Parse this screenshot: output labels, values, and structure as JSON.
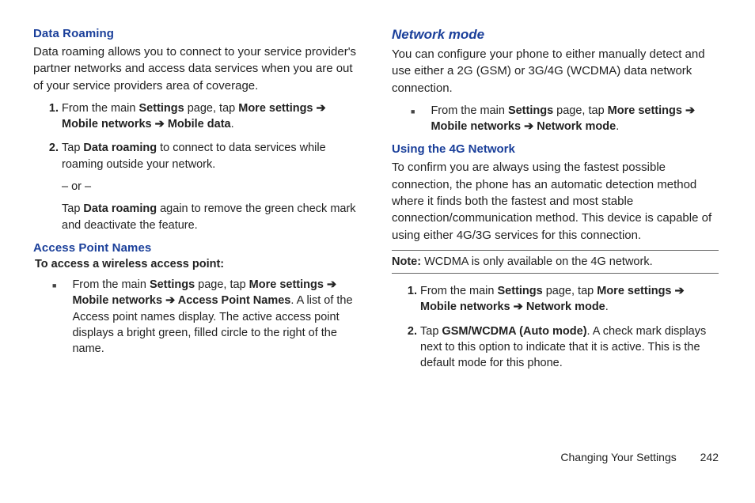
{
  "left": {
    "data_roaming": {
      "heading": "Data Roaming",
      "intro": "Data roaming allows you to connect to your service provider's partner networks and access data services when you are out of your service providers area of coverage.",
      "step1_pre": "From the main ",
      "settings": "Settings",
      "step1_mid": " page, tap ",
      "more_settings": "More settings",
      "arrow": " ➔ ",
      "mobile_networks": "Mobile networks",
      "mobile_data": "Mobile data",
      "period": ".",
      "step2_pre": "Tap ",
      "data_roaming_bold": "Data roaming",
      "step2_post": " to connect to data services while roaming outside your network.",
      "or": "– or –",
      "step2b_pre": "Tap ",
      "step2b_post": " again to remove the green check mark and deactivate the feature."
    },
    "apn": {
      "heading": "Access Point Names",
      "to_access": "To access a wireless access point:",
      "bullet_pre": "From the main ",
      "bullet_mid": " page, tap ",
      "apn_bold": "Access Point Names",
      "bullet_post": ". A list of the Access point names display. The active access point displays a bright green, filled circle to the right of the name."
    }
  },
  "right": {
    "network_mode": {
      "heading": "Network mode",
      "intro": "You can configure your phone to either manually detect and use either a 2G (GSM) or 3G/4G (WCDMA) data network connection.",
      "bullet_pre": "From the main ",
      "bullet_mid": " page, tap ",
      "network_mode_bold": "Network mode",
      "period": "."
    },
    "using_4g": {
      "heading": "Using the 4G Network",
      "intro": "To confirm you are always using the fastest possible connection, the phone has an automatic detection method where it finds both the fastest and most stable connection/communication method. This device is capable of using either 4G/3G services for this connection.",
      "note_label": "Note:",
      "note_text": " WCDMA is only available on the 4G network.",
      "step1_pre": "From the main ",
      "step1_mid": " page, tap ",
      "step2_pre": "Tap ",
      "gsm_wcdma": "GSM/WCDMA (Auto mode)",
      "step2_post": ". A check mark displays next to this option to indicate that it is active. This is the default mode for this phone."
    }
  },
  "footer": {
    "section": "Changing Your Settings",
    "page": "242"
  }
}
